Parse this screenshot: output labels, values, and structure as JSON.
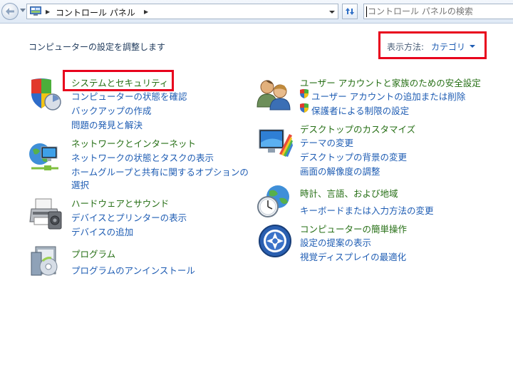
{
  "address_bar": {
    "crumbs": [
      "コントロール パネル"
    ]
  },
  "search": {
    "placeholder": "コントロール パネルの検索"
  },
  "main": {
    "heading": "コンピューターの設定を調整します",
    "view_by": {
      "label": "表示方法:",
      "value": "カテゴリ"
    }
  },
  "categories_left": [
    {
      "icon": "shield-icon",
      "title": "システムとセキュリティ",
      "links": [
        "コンピューターの状態を確認",
        "バックアップの作成",
        "問題の発見と解決"
      ]
    },
    {
      "icon": "network-globe-icon",
      "title": "ネットワークとインターネット",
      "links": [
        "ネットワークの状態とタスクの表示",
        "ホームグループと共有に関するオプションの",
        "選択"
      ]
    },
    {
      "icon": "printer-icon",
      "title": "ハードウェアとサウンド",
      "links": [
        "デバイスとプリンターの表示",
        "デバイスの追加"
      ]
    },
    {
      "icon": "programs-icon",
      "title": "プログラム",
      "links": [
        "プログラムのアンインストール"
      ]
    }
  ],
  "categories_right": [
    {
      "icon": "users-icon",
      "title": "ユーザー アカウントと家族のための安全設定",
      "links": [
        "ユーザー アカウントの追加または削除",
        "保護者による制限の設定"
      ]
    },
    {
      "icon": "desktop-icon",
      "title": "デスクトップのカスタマイズ",
      "links": [
        "テーマの変更",
        "デスクトップの背景の変更",
        "画面の解像度の調整"
      ]
    },
    {
      "icon": "clock-globe-icon",
      "title": "時計、言語、および地域",
      "links": [
        "キーボードまたは入力方法の変更"
      ]
    },
    {
      "icon": "accessibility-icon",
      "title": "コンピューターの簡単操作",
      "links": [
        "設定の提案の表示",
        "視覚ディスプレイの最適化"
      ]
    }
  ],
  "colors": {
    "category_title": "#266f15",
    "link": "#1e5cb3",
    "highlight_border": "#e8001c"
  }
}
